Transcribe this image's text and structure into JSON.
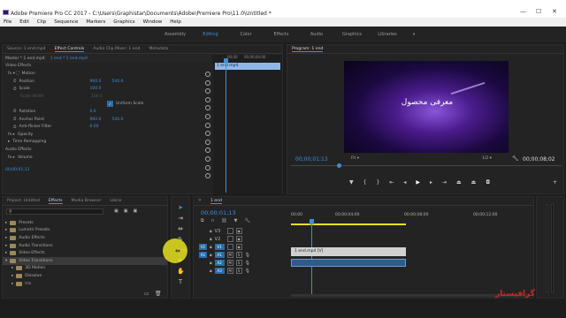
{
  "titlebar": {
    "app_title": "Adobe Premiere Pro CC 2017 - C:\\Users\\Graphistar\\Documents\\Adobe\\Premiere Pro\\11.0\\Untitled *",
    "min": "—",
    "max": "☐",
    "close": "✕"
  },
  "menu": [
    "File",
    "Edit",
    "Clip",
    "Sequence",
    "Markers",
    "Graphics",
    "Window",
    "Help"
  ],
  "workspaces": [
    "Assembly",
    "Editing",
    "Color",
    "Effects",
    "Audio",
    "Graphics",
    "Libraries"
  ],
  "workspaces_more": "»",
  "source_tabs": [
    "Source: 1 end.mp4",
    "Effect Controls",
    "Audio Clip Mixer: 1 end",
    "Metadata"
  ],
  "ec": {
    "master": "Master * 1 end.mp4",
    "seq": "1 end * 1 end.mp4",
    "video_effects": "Video Effects",
    "motion": "Motion",
    "position": "Position",
    "pos_x": "960.0",
    "pos_y": "540.0",
    "scale": "Scale",
    "scale_v": "100.0",
    "scale_width": "Scale Width",
    "scale_width_v": "100.0",
    "uniform": "Uniform Scale",
    "rotation": "Rotation",
    "rot_v": "0.0",
    "anchor": "Anchor Point",
    "anc_x": "960.0",
    "anc_y": "540.0",
    "antiflicker": "Anti-flicker Filter",
    "af_v": "0.00",
    "opacity": "Opacity",
    "time_remap": "Time Remapping",
    "audio_effects": "Audio Effects",
    "volume": "Volume",
    "timecode": "00;00;01;13",
    "ruler_t": "00;00;04;00",
    "ruler_t2": "00;00",
    "clip": "1 end.mp4"
  },
  "program": {
    "title": "Program: 1 end",
    "overlay_text": "معرفی محصول",
    "timecode": "00;00;01;13",
    "fit": "Fit",
    "fraction": "1/2",
    "duration": "00;00;08;02"
  },
  "project_tabs": [
    "Project: Untitled",
    "Effects",
    "Media Browser",
    "Librar"
  ],
  "effects_tree": [
    "Presets",
    "Lumetri Presets",
    "Audio Effects",
    "Audio Transitions",
    "Video Effects",
    "Video Transitions",
    "3D Motion",
    "Dissolve",
    "Iris"
  ],
  "timeline": {
    "seq_tab": "1 end",
    "timecode": "00;00;01;13",
    "ruler": [
      "00;00",
      "00;00;04;00",
      "00;00;08;00",
      "00;00;12;00"
    ],
    "tracks_v": [
      "V3",
      "V2",
      "V1"
    ],
    "tracks_a": [
      "A1",
      "A2",
      "A3"
    ],
    "src_v": "V1",
    "src_a": "A1",
    "video_clip": "1 end.mp4 [V]"
  },
  "watermark": "گرافیستار",
  "colors": {
    "accent": "#3f8fd6",
    "highlight": "#e8e020"
  }
}
